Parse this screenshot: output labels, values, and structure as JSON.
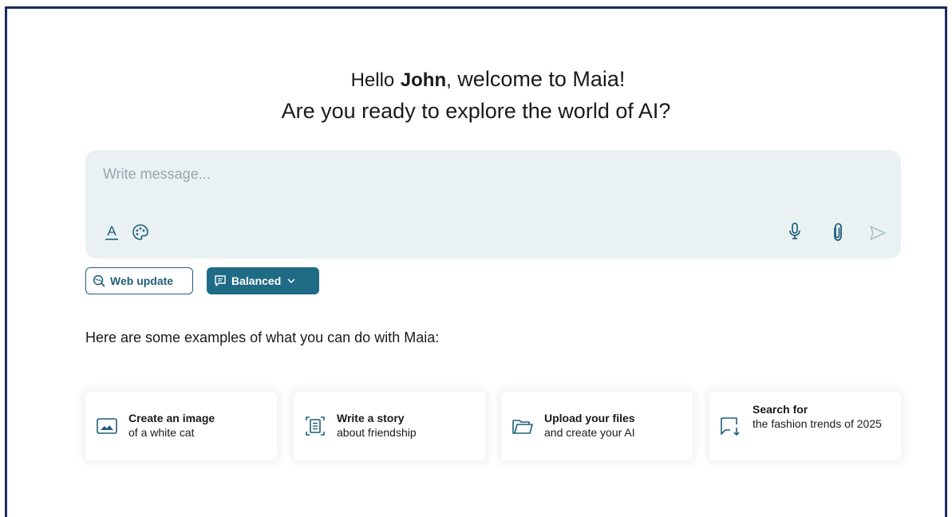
{
  "greeting": {
    "hello": "Hello",
    "name": "John",
    "comma": ",",
    "welcome": "welcome to Maia!",
    "question": "Are you ready to explore the world of AI?"
  },
  "composer": {
    "placeholder": "Write message...",
    "value": "",
    "icons": [
      "text-format-icon",
      "palette-icon",
      "microphone-icon",
      "paperclip-icon",
      "send-icon"
    ]
  },
  "options": {
    "web_update_label": "Web update",
    "mode_label": "Balanced"
  },
  "examples": {
    "heading": "Here are some examples of what you can do with Maia:",
    "cards": [
      {
        "title": "Create an image",
        "subtitle": "of a white cat",
        "icon": "image-icon"
      },
      {
        "title": "Write a story",
        "subtitle": "about friendship",
        "icon": "document-icon"
      },
      {
        "title": "Upload your files",
        "subtitle": "and create your AI",
        "icon": "folder-icon"
      },
      {
        "title": "Search for",
        "subtitle": "the fashion trends of 2025",
        "icon": "search-chat-icon"
      }
    ]
  },
  "colors": {
    "frame_border": "#1d2a5c",
    "accent": "#1f6a85",
    "composer_bg": "#eaf1f3",
    "icon": "#1f5f78"
  }
}
